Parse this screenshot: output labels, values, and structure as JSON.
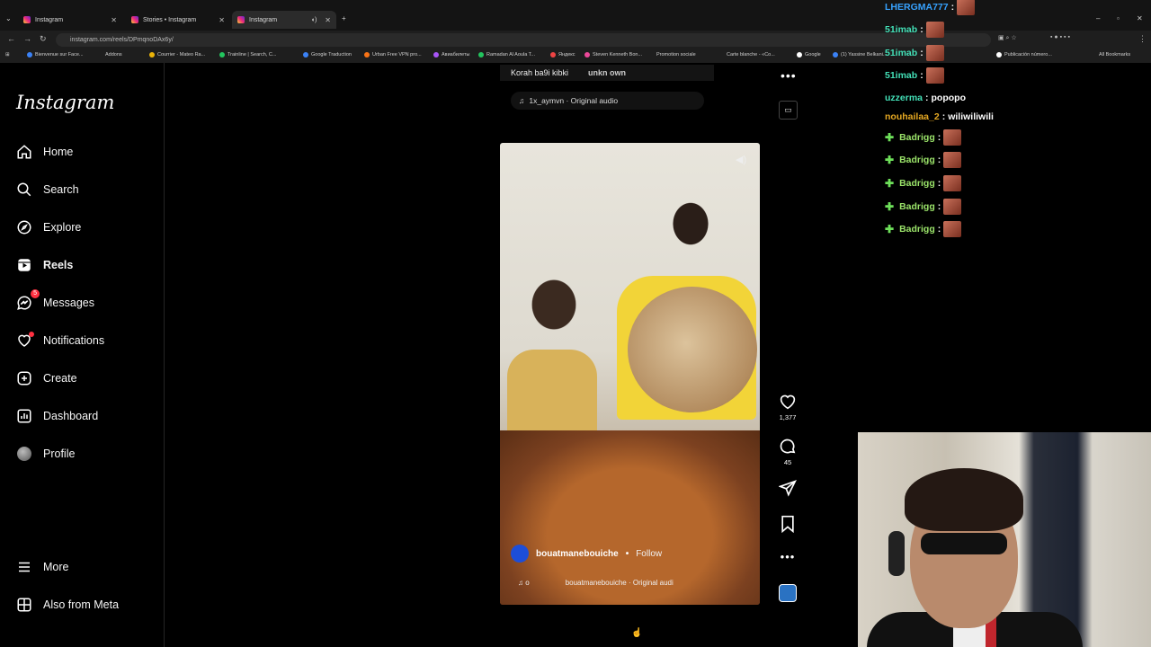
{
  "browser": {
    "tabs": [
      {
        "label": "Instagram"
      },
      {
        "label": "Stories • Instagram"
      },
      {
        "label": "Instagram"
      }
    ],
    "url": "instagram.com/reels/DPmqnoDAx6y/",
    "bookmarks": [
      "Bienvenue sur Face...",
      "Addons",
      "Courrier - Mateo Ra...",
      "Trainline | Search, C...",
      "Google Traduction",
      "Urban Free VPN pro...",
      "Авиабилеты",
      "Ramadan Al Aoula T...",
      "Яндекс",
      "Steven Kenneth Bon...",
      "Promotion sociale",
      "Carte blanche - «Co...",
      "Google",
      "(1) Yassine Belkani...",
      "Publicación número...",
      "All Bookmarks"
    ]
  },
  "sidebar": {
    "logo": "Instagram",
    "items": [
      {
        "label": "Home",
        "icon": "home-icon"
      },
      {
        "label": "Search",
        "icon": "search-icon"
      },
      {
        "label": "Explore",
        "icon": "compass-icon"
      },
      {
        "label": "Reels",
        "icon": "reels-icon"
      },
      {
        "label": "Messages",
        "icon": "messenger-icon",
        "badge": "5"
      },
      {
        "label": "Notifications",
        "icon": "heart-icon"
      },
      {
        "label": "Create",
        "icon": "plus-square-icon"
      },
      {
        "label": "Dashboard",
        "icon": "dashboard-icon"
      },
      {
        "label": "Profile",
        "icon": "avatar"
      }
    ],
    "more": "More",
    "also_from_meta": "Also from Meta"
  },
  "reel": {
    "prev_caption": "Korah ba9i kibki",
    "prev_overlay": "unkn   own",
    "prev_audio": "1x_aymvn · Original audio",
    "author": "bouatmanebouiche",
    "follow": "Follow",
    "audio_prefix": "o",
    "audio": "bouatmanebouiche · Original audi",
    "likes": "1,377",
    "comments": "45"
  },
  "chat": [
    {
      "user": "LHERGMA777",
      "msg": "",
      "emote": true,
      "color": "blue"
    },
    {
      "user": "51imab",
      "msg": "",
      "emote": true,
      "color": "cyan"
    },
    {
      "user": "51imab",
      "msg": "",
      "emote": true,
      "color": "cyan"
    },
    {
      "user": "51imab",
      "msg": "",
      "emote": true,
      "color": "cyan"
    },
    {
      "user": "uzzerma",
      "msg": "popopo",
      "emote": false,
      "color": "cyan"
    },
    {
      "user": "nouhailaa_2",
      "msg": "wiliwiliwili",
      "emote": false,
      "color": "yellow"
    },
    {
      "user": "Badrigg",
      "msg": "",
      "emote": true,
      "color": "green",
      "badge": true
    },
    {
      "user": "Badrigg",
      "msg": "",
      "emote": true,
      "color": "green",
      "badge": true
    },
    {
      "user": "Badrigg",
      "msg": "",
      "emote": true,
      "color": "green",
      "badge": true
    },
    {
      "user": "Badrigg",
      "msg": "",
      "emote": true,
      "color": "green",
      "badge": true
    },
    {
      "user": "Badrigg",
      "msg": "",
      "emote": true,
      "color": "green",
      "badge": true
    }
  ]
}
